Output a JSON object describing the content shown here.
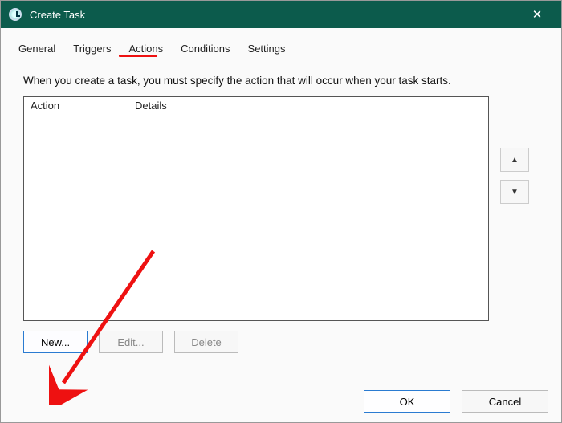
{
  "window": {
    "title": "Create Task",
    "close_glyph": "✕"
  },
  "tabs": {
    "general": "General",
    "triggers": "Triggers",
    "actions": "Actions",
    "conditions": "Conditions",
    "settings": "Settings",
    "active": "actions"
  },
  "instruction": "When you create a task, you must specify the action that will occur when your task starts.",
  "columns": {
    "action": "Action",
    "details": "Details"
  },
  "reorder": {
    "up": "▲",
    "down": "▼"
  },
  "buttons": {
    "new": "New...",
    "edit": "Edit...",
    "delete": "Delete",
    "ok": "OK",
    "cancel": "Cancel"
  },
  "annotation": {
    "underline_color": "#e11",
    "arrow_color": "#e11"
  }
}
